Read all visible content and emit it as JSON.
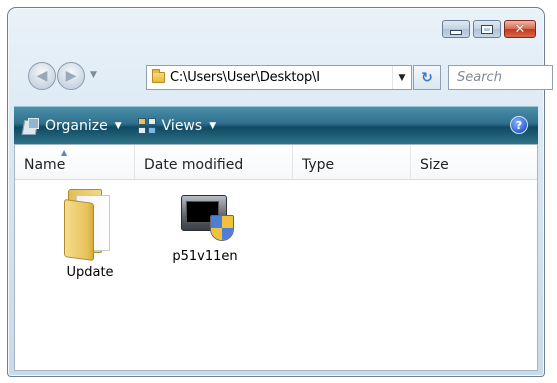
{
  "window": {
    "caption_buttons": {
      "minimize_icon": "minimize-icon",
      "maximize_icon": "maximize-icon",
      "close_glyph": "✕"
    }
  },
  "navigation": {
    "address_path": "C:\\Users\\User\\Desktop\\I",
    "search_placeholder": "Search"
  },
  "toolbar": {
    "organize_label": "Organize",
    "views_label": "Views",
    "help_glyph": "?"
  },
  "columns": [
    {
      "label": "Name"
    },
    {
      "label": "Date modified"
    },
    {
      "label": "Type"
    },
    {
      "label": "Size"
    }
  ],
  "items": [
    {
      "name": "Update",
      "icon": "folder-icon"
    },
    {
      "name": "p51v11en",
      "icon": "installer-icon"
    }
  ],
  "colors": {
    "toolbar_bg": "#2f6f8c",
    "close_button": "#c1381c"
  }
}
